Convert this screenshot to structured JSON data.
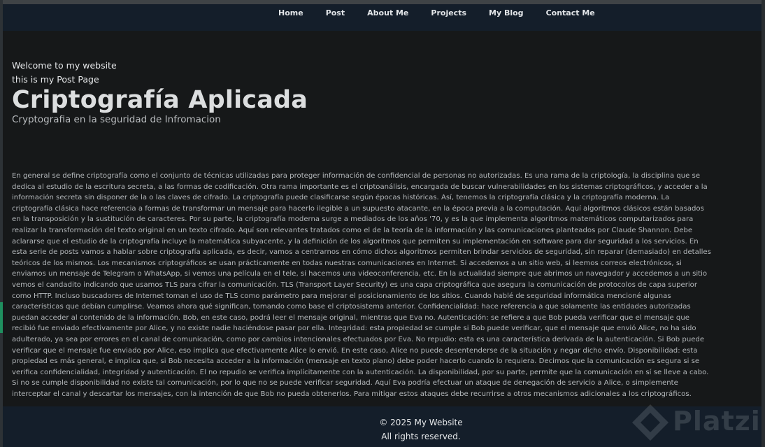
{
  "nav": {
    "items": [
      "Home",
      "Post",
      "About Me",
      "Projects",
      "My Blog",
      "Contact Me"
    ]
  },
  "header": {
    "welcome": "Welcome to my website",
    "page_label": "this is my Post Page",
    "title": "Criptografía Aplicada",
    "subtitle": "Cryptografia en la seguridad de Infromacion"
  },
  "article": {
    "body": "En general se define criptografía como el conjunto de técnicas utilizadas para proteger información de confidencial de personas no autorizadas. Es una rama de la criptología, la disciplina que se dedica al estudio de la escritura secreta, a las formas de codificación. Otra rama importante es el criptoanálisis, encargada de buscar vulnerabilidades en los sistemas criptográficos, y acceder a la información secreta sin disponer de la o las claves de cifrado. La criptografía puede clasificarse según épocas históricas. Así, tenemos la criptografía clásica y la criptografía moderna. La criptografía clásica hace referencia a formas de transformar un mensaje para hacerlo ilegible a un supuesto atacante, en la época previa a la computación. Aquí algoritmos clásicos están basados en la transposición y la sustitución de caracteres. Por su parte, la criptografía moderna surge a mediados de los años '70, y es la que implementa algoritmos matemáticos computarizados para realizar la transformación del texto original en un texto cifrado. Aquí son relevantes tratados como el de la teoría de la información y las comunicaciones planteados por Claude Shannon. Debe aclararse que el estudio de la criptografía incluye la matemática subyacente, y la definición de los algoritmos que permiten su implementación en software para dar seguridad a los servicios. En esta serie de posts vamos a hablar sobre criptografía aplicada, es decir, vamos a centrarnos en cómo dichos algoritmos permiten brindar servicios de seguridad, sin reparar (demasiado) en detalles teóricos de los mismos. Los mecanismos criptográficos se usan prácticamente en todas nuestras comunicaciones en Internet. Si accedemos a un sitio web, si leemos correos electrónicos, si enviamos un mensaje de Telegram o WhatsApp, si vemos una película en el tele, si hacemos una videoconferencia, etc. En la actualidad siempre que abrimos un navegador y accedemos a un sitio vemos el candadito indicando que usamos TLS para cifrar la comunicación. TLS (Transport Layer Security) es una capa criptográfica que asegura la comunicación de protocolos de capa superior como HTTP. Incluso buscadores de Internet toman el uso de TLS como parámetro para mejorar el posicionamiento de los sitios. Cuando hablé de seguridad informática mencioné algunas características que debían cumplirse. Veamos ahora qué significan, tomando como base el criptosistema anterior. Confidencialidad: hace referencia a que solamente las entidades autorizadas puedan acceder al contenido de la información. Bob, en este caso, podrá leer el mensaje original, mientras que Eva no. Autenticación: se refiere a que Bob pueda verificar que el mensaje que recibió fue enviado efectivamente por Alice, y no existe nadie haciéndose pasar por ella. Integridad: esta propiedad se cumple si Bob puede verificar, que el mensaje que envió Alice, no ha sido adulterado, ya sea por errores en el canal de comunicación, como por cambios intencionales efectuados por Eva. No repudio: esta es una característica derivada de la autenticación. Si Bob puede verificar que el mensaje fue enviado por Alice, eso implica que efectivamente Alice lo envió. En este caso, Alice no puede desentenderse de la situación y negar dicho envío. Disponibilidad: esta propiedad es más general, e implica que, si Bob necesita acceder a la información (mensaje en texto plano) debe poder hacerlo cuando lo requiera. Decimos que la comunicación es segura si se verifica confidencialidad, integridad y autenticación. El no repudio se verifica implícitamente con la autenticación. La disponibilidad, por su parte, permite que la comunicación en sí se lleve a cabo. Si no se cumple disponibilidad no existe tal comunicación, por lo que no se puede verificar seguridad. Aquí Eva podría efectuar un ataque de denegación de servicio a Alice, o simplemente interceptar el canal y descartar los mensajes, con la intención de que Bob no pueda obtenerlos. Para mitigar estos ataques debe recurrirse a otros mecanismos adicionales a los criptográficos."
  },
  "footer": {
    "copyright": "© 2025 My Website",
    "rights": "All rights reserved."
  },
  "watermark": {
    "brand": "Platzi",
    "icon": "platzi-logo-icon"
  },
  "colors": {
    "page_background": "#161819",
    "navbar_background": "#141e2a",
    "footer_background": "#141e2a",
    "accent_green": "#1f8f5f"
  }
}
